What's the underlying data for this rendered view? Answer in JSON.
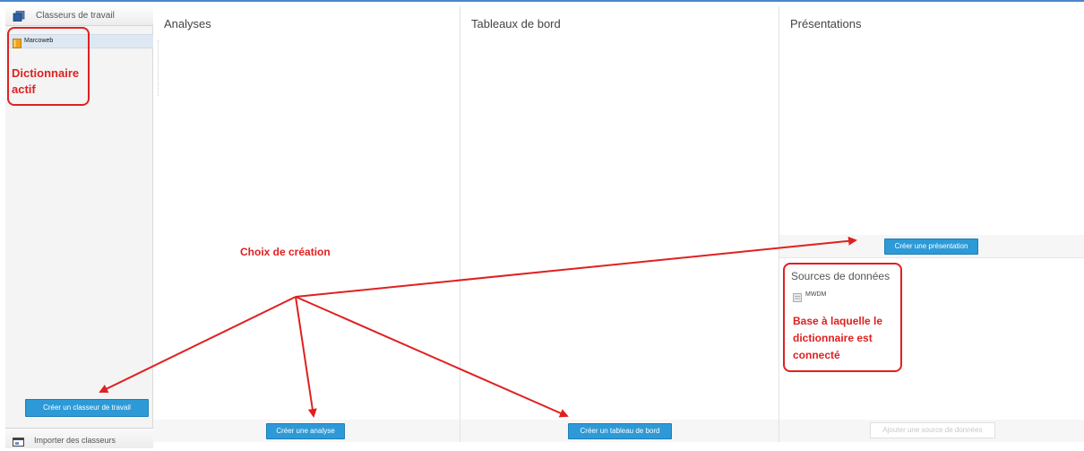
{
  "sidebar": {
    "header_label": "Classeurs de travail",
    "items": [
      {
        "label": "Marcoweb"
      }
    ],
    "create_button": "Créer un classeur de travail",
    "import_label": "Importer des classeurs"
  },
  "columns": {
    "analyses": {
      "title": "Analyses",
      "create_button": "Créer une analyse"
    },
    "dashboards": {
      "title": "Tableaux de bord",
      "create_button": "Créer un tableau de bord"
    },
    "presentations": {
      "title": "Présentations",
      "create_button": "Créer une présentation"
    }
  },
  "data_sources": {
    "title": "Sources de données",
    "items": [
      {
        "label": "MWDM"
      }
    ],
    "add_button": "Ajouter une source de données"
  },
  "annotations": {
    "active_dictionary": "Dictionnaire actif",
    "creation_choice": "Choix de création",
    "base_connected": "Base à laquelle le dictionnaire est connecté"
  },
  "colors": {
    "accent": "#2d9ad7",
    "annotation": "#e02020"
  }
}
